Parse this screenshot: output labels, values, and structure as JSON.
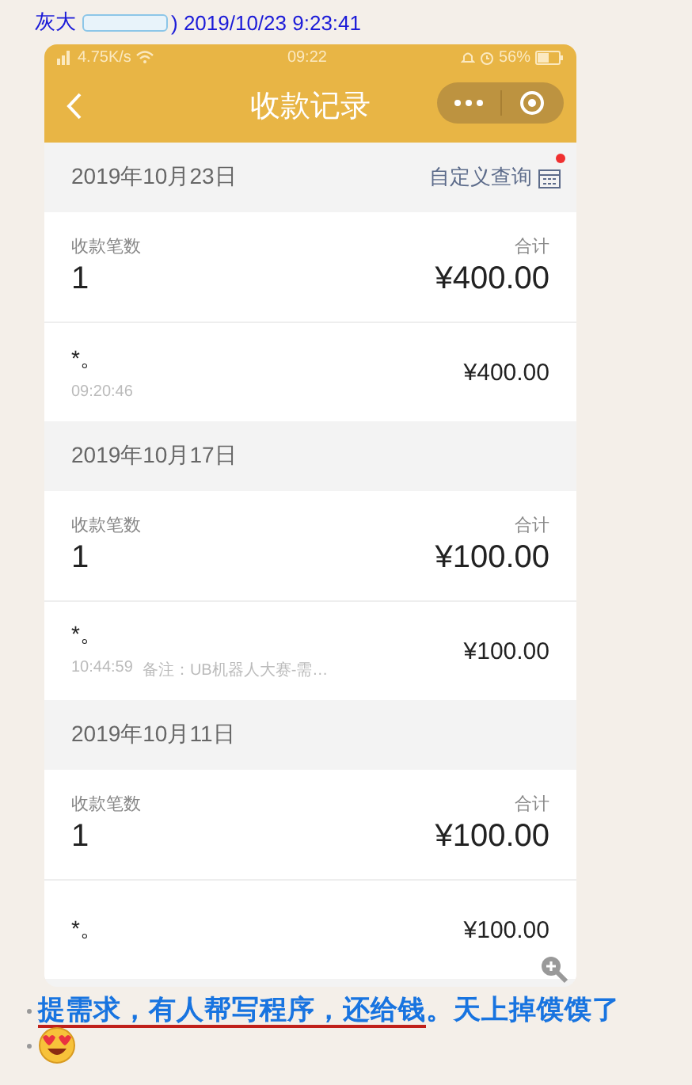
{
  "chat_header": {
    "sender": "灰大",
    "timestamp": ") 2019/10/23 9:23:41"
  },
  "phone": {
    "status_bar": {
      "network_speed": "4.75K/s",
      "time": "09:22",
      "battery": "56%"
    },
    "nav": {
      "title": "收款记录"
    },
    "custom_query": {
      "label": "自定义查询",
      "badge": true
    },
    "days": [
      {
        "date": "2019年10月23日",
        "count_label": "收款笔数",
        "count": "1",
        "total_label": "合计",
        "total": "¥400.00",
        "records": [
          {
            "payer": "*。",
            "time": "09:20:46",
            "amount": "¥400.00"
          }
        ]
      },
      {
        "date": "2019年10月17日",
        "count_label": "收款笔数",
        "count": "1",
        "total_label": "合计",
        "total": "¥100.00",
        "records": [
          {
            "payer": "*。",
            "time": "10:44:59",
            "note": "备注：UB机器人大赛-需…",
            "amount": "¥100.00"
          }
        ]
      },
      {
        "date": "2019年10月11日",
        "count_label": "收款笔数",
        "count": "1",
        "total_label": "合计",
        "total": "¥100.00",
        "records": [
          {
            "payer": "*。",
            "amount": "¥100.00"
          }
        ]
      }
    ]
  },
  "message": {
    "parts": [
      {
        "text": "提需求，有人帮写程序，还给钱",
        "underlined": true
      },
      {
        "text": "。天上掉馍馍了",
        "underlined": false
      }
    ]
  }
}
